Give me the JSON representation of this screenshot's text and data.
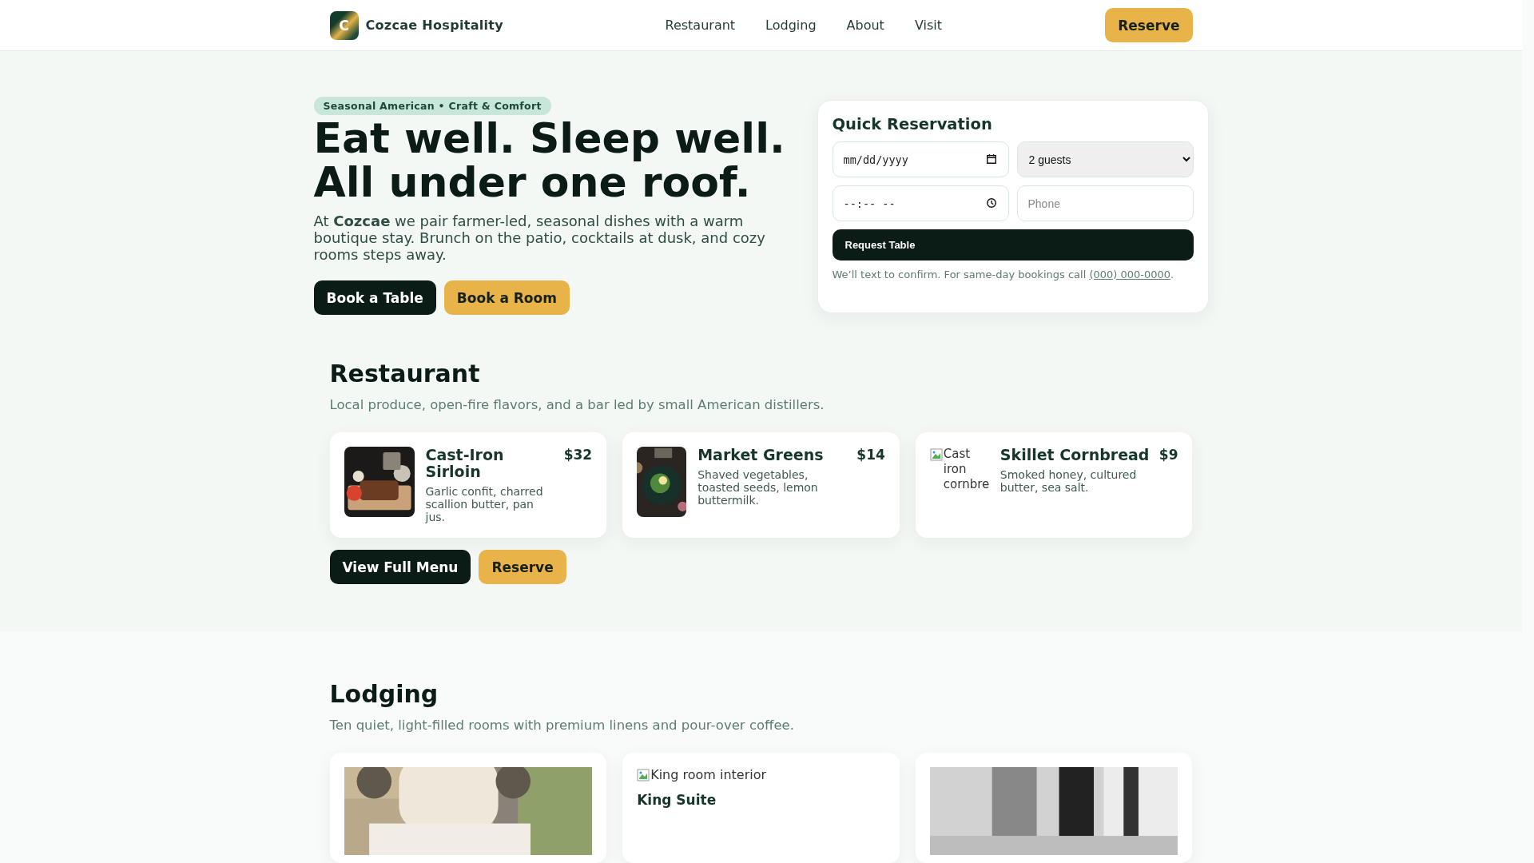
{
  "header": {
    "logo_letter": "C",
    "brand": "Cozcae Hospitality",
    "nav": [
      "Restaurant",
      "Lodging",
      "About",
      "Visit"
    ],
    "cta": "Reserve"
  },
  "hero": {
    "tag": "Seasonal American • Craft & Comfort",
    "headline": [
      "Eat well. Sleep well.",
      "All under one roof."
    ],
    "text": "At **Cozcae** we pair farmer-led, seasonal dishes with a warm boutique stay. Brunch on the patio, cocktails at dusk, and cozy rooms steps away.",
    "buttons": [
      {
        "label": "Book a Table",
        "kind": "primary"
      },
      {
        "label": "Book a Room",
        "kind": "accent"
      }
    ]
  },
  "reservation": {
    "title": "Quick Reservation",
    "date": {
      "placeholder": "mm/dd/yyyy"
    },
    "guests": {
      "value": "2 guests"
    },
    "time": {
      "placeholder": "--:-- --"
    },
    "phone": {
      "placeholder": "Phone"
    },
    "submit": "Request Table",
    "note": "We’ll text to confirm. For same-day bookings call ",
    "note_link": "(000) 000-0000",
    "note_end": "."
  },
  "restaurant": {
    "title": "Restaurant",
    "subtitle": "Local produce, open-fire flavors, and a bar led by small American distillers.",
    "items": [
      {
        "name": "Cast-Iron Sirloin",
        "price": "$32",
        "description": "Garlic confit, charred scallion butter, pan jus.",
        "image": {
          "kind": "picture"
        }
      },
      {
        "name": "Market Greens",
        "price": "$14",
        "description": "Shaved vegetables, toasted seeds, lemon buttermilk.",
        "image": {
          "kind": "picture"
        }
      },
      {
        "name": "Skillet Cornbread",
        "price": "$9",
        "description": "Smoked honey, cultured butter, sea salt.",
        "image": {
          "kind": "broken",
          "alt": "Cast iron cornbre"
        }
      }
    ],
    "buttons": [
      {
        "label": "View Full Menu",
        "kind": "primary"
      },
      {
        "label": "Reserve",
        "kind": "accent"
      }
    ]
  },
  "lodging": {
    "title": "Lodging",
    "subtitle": "Ten quiet, light-filled rooms with premium linens and pour-over coffee.",
    "rooms": [
      {
        "image": {
          "kind": "picture"
        }
      },
      {
        "image": {
          "kind": "broken",
          "alt": "King room interior"
        },
        "name": "King Suite"
      },
      {
        "image": {
          "kind": "picture"
        }
      }
    ]
  }
}
